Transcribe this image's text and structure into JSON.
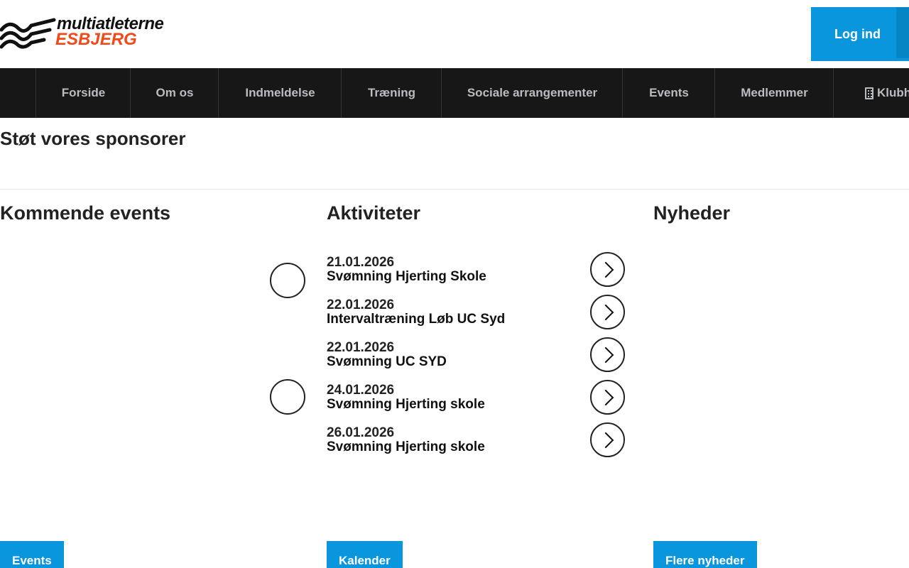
{
  "header": {
    "logo_line1": "multiatleterne",
    "logo_line2": "ESBJERG",
    "login_label": "Log ind"
  },
  "nav": {
    "items": [
      {
        "label": "Forside"
      },
      {
        "label": "Om os"
      },
      {
        "label": "Indmeldelse"
      },
      {
        "label": "Træning"
      },
      {
        "label": "Sociale arrangementer"
      },
      {
        "label": "Events"
      },
      {
        "label": "Medlemmer"
      },
      {
        "label": "Klubhus",
        "icon": "building-icon"
      }
    ]
  },
  "sponsors": {
    "title": "Støt vores sponsorer"
  },
  "events": {
    "title": "Kommende events",
    "button_label": "Events"
  },
  "activities": {
    "title": "Aktiviteter",
    "items": [
      {
        "date": "21.01.2026",
        "name": "Svømning Hjerting Skole"
      },
      {
        "date": "22.01.2026",
        "name": "Intervaltræning Løb UC Syd"
      },
      {
        "date": "22.01.2026",
        "name": "Svømning UC SYD"
      },
      {
        "date": "24.01.2026",
        "name": "Svømning Hjerting skole"
      },
      {
        "date": "26.01.2026",
        "name": "Svømning Hjerting skole"
      }
    ],
    "button_label": "Kalender"
  },
  "news": {
    "title": "Nyheder",
    "button_label": "Flere nyheder"
  },
  "colors": {
    "accent": "#0a96dc",
    "brand_orange": "#f04a1b",
    "nav_bg": "#171717"
  }
}
